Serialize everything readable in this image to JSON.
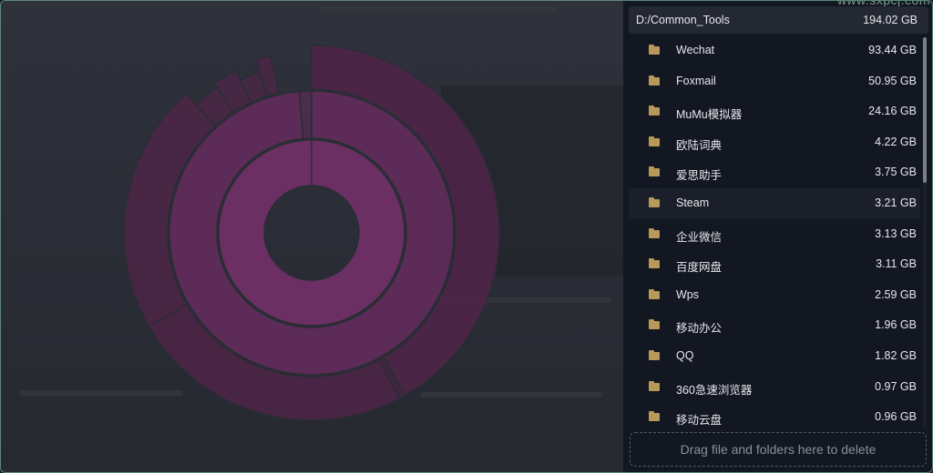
{
  "watermark": "www.sxpcj.com",
  "header": {
    "path": "D:/Common_Tools",
    "size": "194.02 GB"
  },
  "items": [
    {
      "name": "Wechat",
      "size": "93.44 GB"
    },
    {
      "name": "Foxmail",
      "size": "50.95 GB"
    },
    {
      "name": "MuMu模拟器",
      "size": "24.16 GB"
    },
    {
      "name": "欧陆词典",
      "size": "4.22 GB"
    },
    {
      "name": "爱思助手",
      "size": "3.75 GB"
    },
    {
      "name": "Steam",
      "size": "3.21 GB"
    },
    {
      "name": "企业微信",
      "size": "3.13 GB"
    },
    {
      "name": "百度网盘",
      "size": "3.11 GB"
    },
    {
      "name": "Wps",
      "size": "2.59 GB"
    },
    {
      "name": "移动办公",
      "size": "1.96 GB"
    },
    {
      "name": "QQ",
      "size": "1.82 GB"
    },
    {
      "name": "360急速浏览器",
      "size": "0.97 GB"
    },
    {
      "name": "移动云盘",
      "size": "0.96 GB"
    }
  ],
  "dropzone": {
    "label": "Drag file and folders here to delete"
  },
  "colors": {
    "accent": "#6b2f63",
    "ring_mid": "#5f2b5a",
    "ring_outer": "#4f2548",
    "panel": "#121722",
    "folder": "#b8995a"
  }
}
